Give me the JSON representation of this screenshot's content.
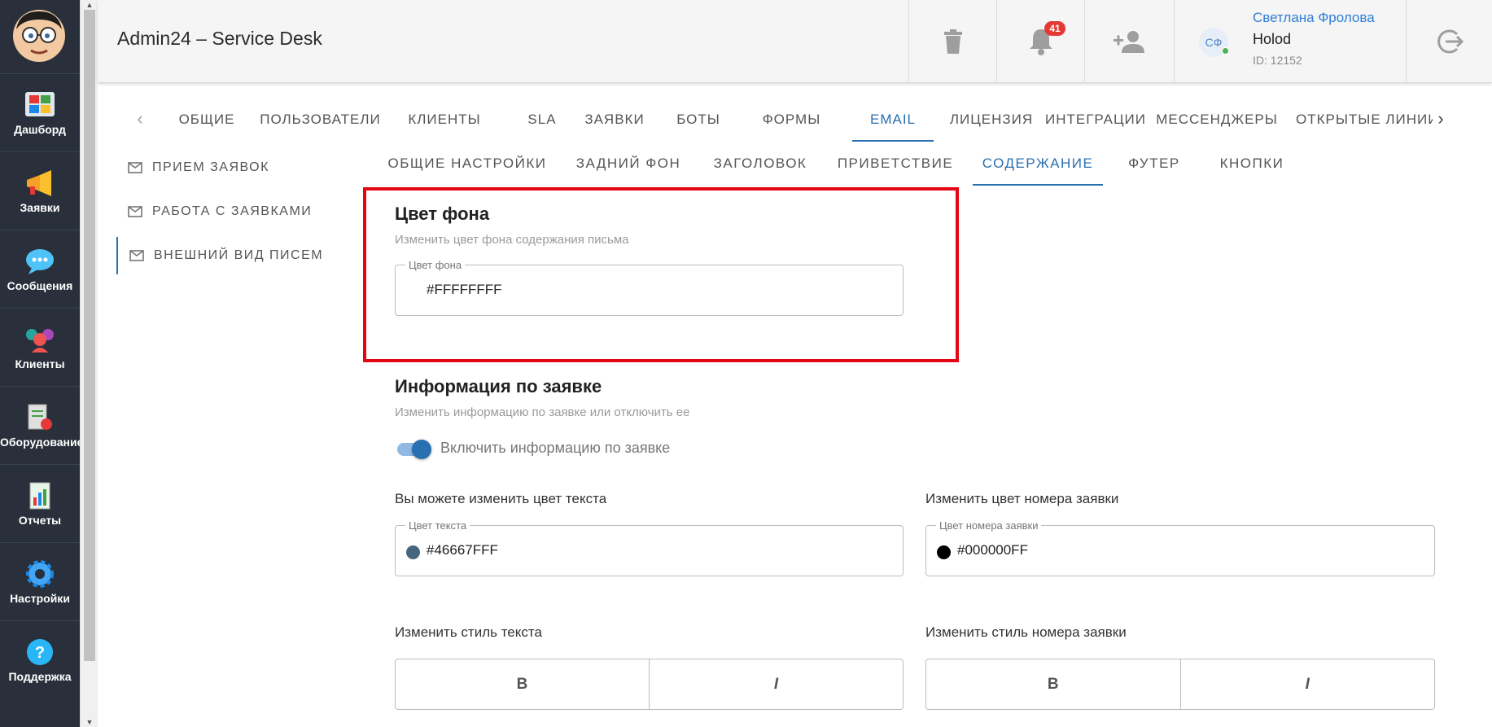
{
  "app": {
    "title": "Admin24 – Service Desk"
  },
  "rail": {
    "items": [
      {
        "label": "Дашборд",
        "icon": "dashboard-icon"
      },
      {
        "label": "Заявки",
        "icon": "megaphone-icon"
      },
      {
        "label": "Сообщения",
        "icon": "chat-bubble-icon"
      },
      {
        "label": "Клиенты",
        "icon": "clients-icon"
      },
      {
        "label": "Оборудование",
        "icon": "equipment-icon"
      },
      {
        "label": "Отчеты",
        "icon": "reports-icon"
      },
      {
        "label": "Настройки",
        "icon": "settings-gear-icon"
      },
      {
        "label": "Поддержка",
        "icon": "help-icon"
      }
    ]
  },
  "topbar": {
    "notifications_count": "41",
    "user": {
      "initials": "СФ",
      "name": "Светлана Фролова",
      "org": "Holod",
      "id": "ID: 12152"
    }
  },
  "main_tabs": {
    "items": [
      "ОБЩИЕ",
      "ПОЛЬЗОВАТЕЛИ",
      "КЛИЕНТЫ",
      "SLA",
      "ЗАЯВКИ",
      "БОТЫ",
      "ФОРМЫ",
      "EMAIL",
      "ЛИЦЕНЗИЯ",
      "ИНТЕГРАЦИИ",
      "МЕССЕНДЖЕРЫ",
      "ОТКРЫТЫЕ ЛИНИИ"
    ],
    "active": "EMAIL"
  },
  "side_menu": {
    "items": [
      "ПРИЕМ ЗАЯВОК",
      "РАБОТА С ЗАЯВКАМИ",
      "ВНЕШНИЙ ВИД ПИСЕМ"
    ],
    "active": "ВНЕШНИЙ ВИД ПИСЕМ"
  },
  "sub_tabs": {
    "items": [
      "ОБЩИЕ НАСТРОЙКИ",
      "ЗАДНИЙ ФОН",
      "ЗАГОЛОВОК",
      "ПРИВЕТСТВИЕ",
      "СОДЕРЖАНИЕ",
      "ФУТЕР",
      "КНОПКИ"
    ],
    "active": "СОДЕРЖАНИЕ"
  },
  "background": {
    "title": "Цвет фона",
    "description": "Изменить цвет фона содержания письма",
    "field_label": "Цвет фона",
    "value": "#FFFFFFFF"
  },
  "ticket_info": {
    "title": "Информация по заявке",
    "description": "Изменить информацию по заявке или отключить ее",
    "toggle_label": "Включить информацию по заявке",
    "toggle_on": true,
    "text_color": {
      "heading": "Вы можете изменить цвет текста",
      "field_label": "Цвет текста",
      "value": "#46667FFF",
      "swatch": "#46667F"
    },
    "number_color": {
      "heading": "Изменить цвет номера заявки",
      "field_label": "Цвет номера заявки",
      "value": "#000000FF",
      "swatch": "#000000"
    },
    "text_style": {
      "heading": "Изменить стиль текста",
      "bold": "B",
      "italic": "I"
    },
    "number_style": {
      "heading": "Изменить стиль номера заявки",
      "bold": "B",
      "italic": "I"
    }
  },
  "colors": {
    "accent": "#2a6fb0",
    "highlight": "#e30613",
    "rail_bg": "#29303b"
  }
}
